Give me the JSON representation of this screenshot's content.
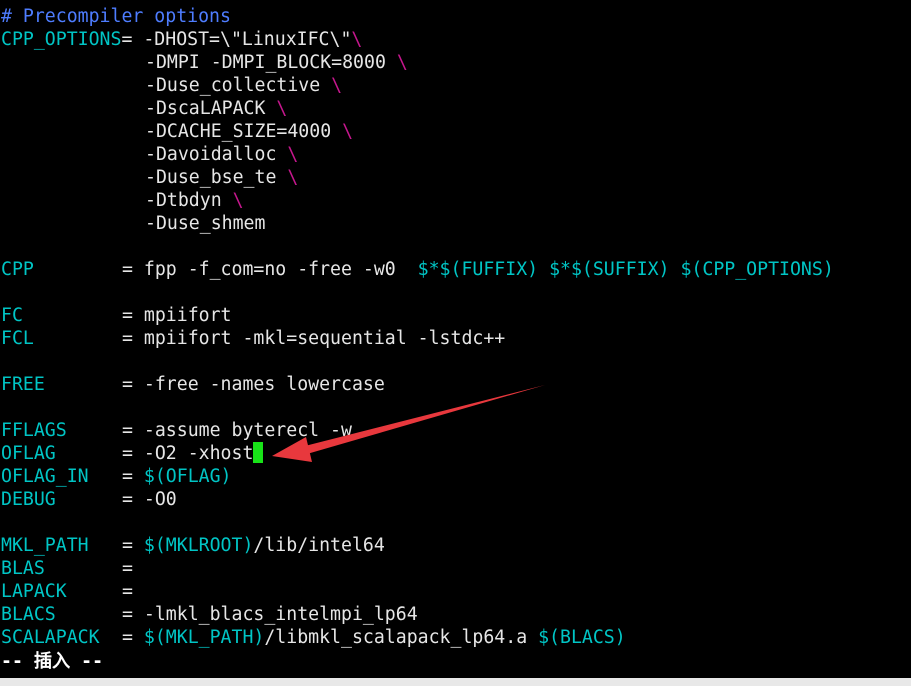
{
  "editor": {
    "comment": "# Precompiler options",
    "cpp_options": {
      "name": "CPP_OPTIONS",
      "eq": "= ",
      "first": "-DHOST=\\\"LinuxIFC\\\"",
      "continuation": [
        "-DMPI -DMPI_BLOCK=8000",
        "-Duse_collective",
        "-DscaLAPACK",
        "-DCACHE_SIZE=4000",
        "-Davoidalloc",
        "-Duse_bse_te",
        "-Dtbdyn"
      ],
      "last": "-Duse_shmem",
      "backslash": "\\"
    },
    "cpp": {
      "name": "CPP",
      "eq": "= ",
      "plain": "fpp -f_com=no -free -w0  ",
      "dollar1": "$*$(FUFFIX)",
      "dollar2": "$*$(SUFFIX)",
      "dollar3": "$(CPP_OPTIONS)"
    },
    "fc": {
      "name": "FC",
      "eq": "= ",
      "value": "mpiifort"
    },
    "fcl": {
      "name": "FCL",
      "eq": "= ",
      "value": "mpiifort -mkl=sequential -lstdc++"
    },
    "free": {
      "name": "FREE",
      "eq": "= ",
      "value": "-free -names lowercase"
    },
    "fflags": {
      "name": "FFLAGS",
      "eq": "= ",
      "value": "-assume byterecl -w"
    },
    "oflag": {
      "name": "OFLAG",
      "eq": "= ",
      "value": "-O2 -xhost"
    },
    "oflag_in": {
      "name": "OFLAG_IN",
      "eq": "= ",
      "dollar": "$(OFLAG)"
    },
    "debug": {
      "name": "DEBUG",
      "eq": "= ",
      "value": "-O0"
    },
    "mkl_path": {
      "name": "MKL_PATH",
      "eq": "= ",
      "dollar": "$(MKLROOT)",
      "rest": "/lib/intel64"
    },
    "blas": {
      "name": "BLAS",
      "eq": "="
    },
    "lapack": {
      "name": "LAPACK",
      "eq": "="
    },
    "blacs": {
      "name": "BLACS",
      "eq": "= ",
      "value": "-lmkl_blacs_intelmpi_lp64"
    },
    "scalapack": {
      "name": "SCALAPACK",
      "eq": "= ",
      "dollar1": "$(MKL_PATH)",
      "rest": "/libmkl_scalapack_lp64.a ",
      "dollar2": "$(BLACS)"
    }
  },
  "status": {
    "mode": "-- 插入 --"
  },
  "colors": {
    "background": "#000000",
    "variable": "#00c5c5",
    "comment": "#4e7dff",
    "backslash": "#c5178d",
    "cursor": "#18e318",
    "arrow": "#e8383d"
  }
}
